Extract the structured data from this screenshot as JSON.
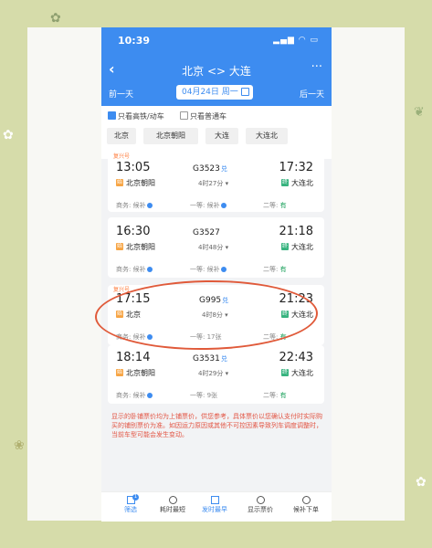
{
  "status": {
    "time": "10:39"
  },
  "nav": {
    "title": "北京 <> 大连"
  },
  "datebar": {
    "prev": "前一天",
    "date": "04月24日 周一",
    "next": "后一天"
  },
  "filters": {
    "only_high_speed": "只看高铁/动车",
    "only_normal": "只看普通车"
  },
  "stations": [
    "北京",
    "北京朝阳",
    "大连",
    "大连北"
  ],
  "trains": [
    {
      "ribbon": "复兴号",
      "dep": "13:05",
      "num": "G3523",
      "fx": "兑",
      "arr": "17:32",
      "duration": "4时27分",
      "from": "北京朝阳",
      "to": "大连北",
      "business": "商务: 候补",
      "first": "一等: 候补",
      "second_label": "二等: ",
      "second_val": "有"
    },
    {
      "ribbon": "",
      "dep": "16:30",
      "num": "G3527",
      "fx": "",
      "arr": "21:18",
      "duration": "4时48分",
      "from": "北京朝阳",
      "to": "大连北",
      "business": "商务: 候补",
      "first": "一等: 候补",
      "second_label": "二等: ",
      "second_val": "有"
    },
    {
      "ribbon": "复兴号",
      "dep": "17:15",
      "num": "G995",
      "fx": "兑",
      "arr": "21:23",
      "duration": "4时8分",
      "from": "北京",
      "to": "大连北",
      "business": "商务: 候补",
      "first": "一等: 17张",
      "second_label": "二等: ",
      "second_val": "有"
    },
    {
      "ribbon": "",
      "dep": "18:14",
      "num": "G3531",
      "fx": "兑",
      "arr": "22:43",
      "duration": "4时29分",
      "from": "北京朝阳",
      "to": "大连北",
      "business": "商务: 候补",
      "first": "一等: 9张",
      "second_label": "二等: ",
      "second_val": "有"
    }
  ],
  "note": "显示的卧铺票价均为上铺票价，供您参考，具体票价以您确认支付时实际购买的铺别票价为准。如因运力原因或其他不可控因素导致列车调度调整时，当前车型可能会发生变动。",
  "tabbar": {
    "items": [
      "筛选",
      "耗时最短",
      "发时最早",
      "显示票价",
      "候补下单"
    ],
    "badge": "1"
  },
  "colors": {
    "primary": "#3d8cf0",
    "annotation": "#e05a3a",
    "background": "#d6dcaa"
  }
}
